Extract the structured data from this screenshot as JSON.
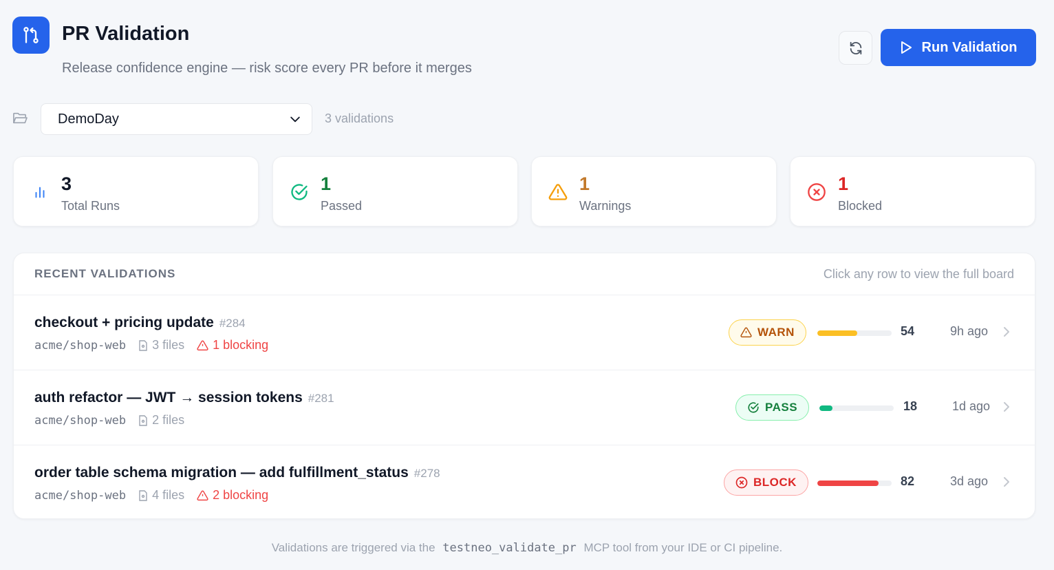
{
  "header": {
    "title": "PR Validation",
    "subtitle": "Release confidence engine — risk score every PR before it merges",
    "run_button_label": "Run Validation"
  },
  "project": {
    "selected": "DemoDay",
    "count_text": "3 validations"
  },
  "stats": [
    {
      "value": "3",
      "label": "Total Runs",
      "icon": "bar-chart-icon",
      "color": "#111827"
    },
    {
      "value": "1",
      "label": "Passed",
      "icon": "check-circle-icon",
      "color": "#15803d"
    },
    {
      "value": "1",
      "label": "Warnings",
      "icon": "warning-triangle-icon",
      "color": "#c2792b"
    },
    {
      "value": "1",
      "label": "Blocked",
      "icon": "x-circle-icon",
      "color": "#dc2626"
    }
  ],
  "recent": {
    "title": "RECENT VALIDATIONS",
    "hint": "Click any row to view the full board",
    "rows": [
      {
        "title": "checkout + pricing update",
        "number": "#284",
        "repo": "acme/shop-web",
        "files": "3 files",
        "blocking": "1 blocking",
        "status": "WARN",
        "score": "54",
        "age": "9h ago"
      },
      {
        "title": "auth refactor — JWT → session tokens",
        "number": "#281",
        "repo": "acme/shop-web",
        "files": "2 files",
        "blocking": "",
        "status": "PASS",
        "score": "18",
        "age": "1d ago"
      },
      {
        "title": "order table schema migration — add fulfillment_status",
        "number": "#278",
        "repo": "acme/shop-web",
        "files": "4 files",
        "blocking": "2 blocking",
        "status": "BLOCK",
        "score": "82",
        "age": "3d ago"
      }
    ]
  },
  "footer": {
    "before": "Validations are triggered via the",
    "code": "testneo_validate_pr",
    "after": "MCP tool from your IDE or CI pipeline."
  },
  "colors": {
    "accent": "#2563eb",
    "warn": "#fbbf24",
    "pass": "#10b981",
    "block": "#ef4444"
  }
}
